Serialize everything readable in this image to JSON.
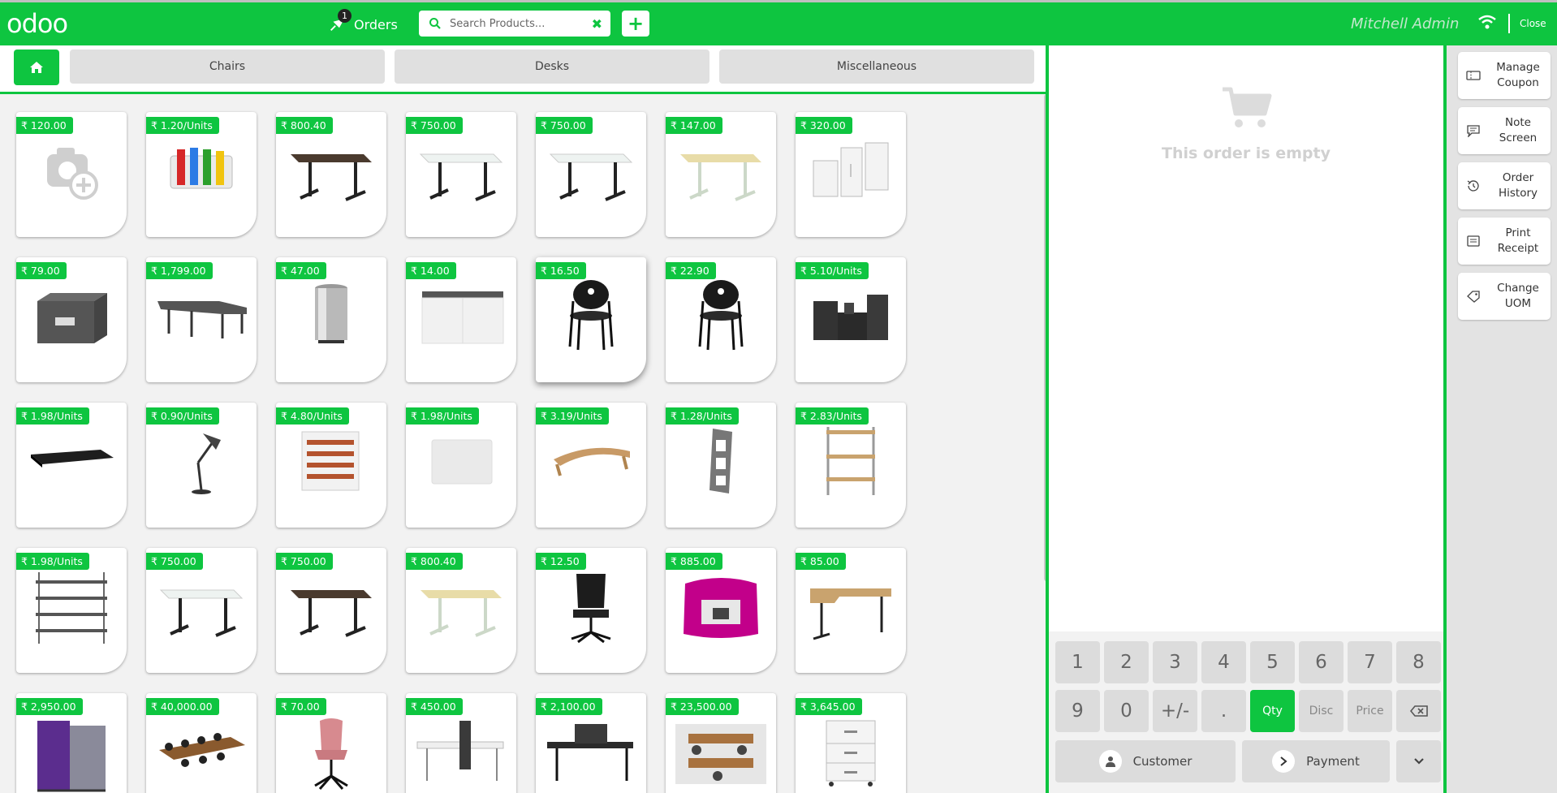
{
  "topbar": {
    "logo": "odoo",
    "orders_label": "Orders",
    "orders_count": "1",
    "search_placeholder": "Search Products...",
    "search_clear": "✖",
    "add_label": "+",
    "user_name": "Mitchell Admin",
    "close_label": "Close"
  },
  "categories": [
    {
      "label": "Chairs"
    },
    {
      "label": "Desks"
    },
    {
      "label": "Miscellaneous"
    }
  ],
  "products": [
    {
      "price": "₹ 120.00",
      "icon": "camera-placeholder"
    },
    {
      "price": "₹ 1.20/Units",
      "icon": "markers"
    },
    {
      "price": "₹ 800.40",
      "icon": "desk-dark"
    },
    {
      "price": "₹ 750.00",
      "icon": "desk-white"
    },
    {
      "price": "₹ 750.00",
      "icon": "desk-white"
    },
    {
      "price": "₹ 147.00",
      "icon": "desk-light"
    },
    {
      "price": "₹ 320.00",
      "icon": "cabinets"
    },
    {
      "price": "₹ 79.00",
      "icon": "box"
    },
    {
      "price": "₹ 1,799.00",
      "icon": "large-desk"
    },
    {
      "price": "₹ 47.00",
      "icon": "bin"
    },
    {
      "price": "₹ 14.00",
      "icon": "cabinet-white"
    },
    {
      "price": "₹ 16.50",
      "icon": "chair"
    },
    {
      "price": "₹ 22.90",
      "icon": "chair"
    },
    {
      "price": "₹ 5.10/Units",
      "icon": "organizer"
    },
    {
      "price": "₹ 1.98/Units",
      "icon": "desk-pad"
    },
    {
      "price": "₹ 0.90/Units",
      "icon": "lamp"
    },
    {
      "price": "₹ 4.80/Units",
      "icon": "letter-tray"
    },
    {
      "price": "₹ 1.98/Units",
      "icon": "whiteboard"
    },
    {
      "price": "₹ 3.19/Units",
      "icon": "monitor-stand"
    },
    {
      "price": "₹ 1.28/Units",
      "icon": "magazine-rack"
    },
    {
      "price": "₹ 2.83/Units",
      "icon": "wall-shelf"
    },
    {
      "price": "₹ 1.98/Units",
      "icon": "shelf-unit"
    },
    {
      "price": "₹ 750.00",
      "icon": "desk-white"
    },
    {
      "price": "₹ 750.00",
      "icon": "desk-dark"
    },
    {
      "price": "₹ 800.40",
      "icon": "desk-light"
    },
    {
      "price": "₹ 12.50",
      "icon": "office-chair"
    },
    {
      "price": "₹ 885.00",
      "icon": "pod"
    },
    {
      "price": "₹ 85.00",
      "icon": "corner-desk"
    },
    {
      "price": "₹ 2,950.00",
      "icon": "screen"
    },
    {
      "price": "₹ 40,000.00",
      "icon": "conference-table"
    },
    {
      "price": "₹ 70.00",
      "icon": "pink-chair"
    },
    {
      "price": "₹ 450.00",
      "icon": "desk-divider"
    },
    {
      "price": "₹ 2,100.00",
      "icon": "desk-divider-dark"
    },
    {
      "price": "₹ 23,500.00",
      "icon": "workstation"
    },
    {
      "price": "₹ 3,645.00",
      "icon": "drawer"
    }
  ],
  "order": {
    "empty_text": "This order is empty"
  },
  "numpad": {
    "row1": [
      "1",
      "2",
      "3",
      "4",
      "5",
      "6",
      "7",
      "8"
    ],
    "row2": [
      "9",
      "0",
      "+/-",
      ".",
      "Qty",
      "Disc",
      "Price"
    ],
    "customer_label": "Customer",
    "payment_label": "Payment"
  },
  "tools": [
    {
      "label": "Manage Coupon",
      "icon": "coupon-icon"
    },
    {
      "label": "Note Screen",
      "icon": "note-icon"
    },
    {
      "label": "Order History",
      "icon": "history-icon"
    },
    {
      "label": "Print Receipt",
      "icon": "receipt-icon"
    },
    {
      "label": "Change UOM",
      "icon": "tag-icon"
    }
  ],
  "colors": {
    "brand": "#0ec540",
    "panel": "#ffffff",
    "background": "#f2f2f2",
    "key": "#dcdcdc"
  }
}
